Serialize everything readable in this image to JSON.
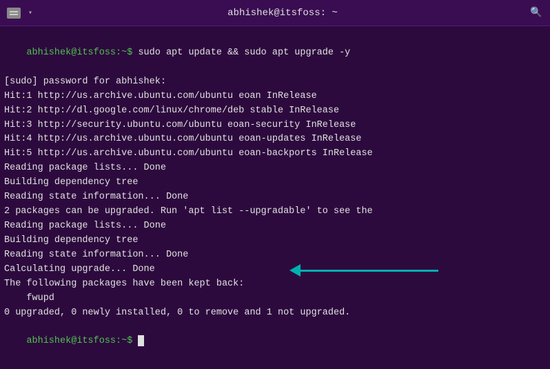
{
  "titleBar": {
    "title": "abhishek@itsfoss: ~",
    "searchIcon": "🔍"
  },
  "terminal": {
    "lines": [
      {
        "type": "prompt-command",
        "prompt": "abhishek@itsfoss:~$ ",
        "command": "sudo apt update && sudo apt upgrade -y"
      },
      {
        "type": "normal",
        "text": "[sudo] password for abhishek:"
      },
      {
        "type": "normal",
        "text": "Hit:1 http://us.archive.ubuntu.com/ubuntu eoan InRelease"
      },
      {
        "type": "normal",
        "text": "Hit:2 http://dl.google.com/linux/chrome/deb stable InRelease"
      },
      {
        "type": "normal",
        "text": "Hit:3 http://security.ubuntu.com/ubuntu eoan-security InRelease"
      },
      {
        "type": "normal",
        "text": "Hit:4 http://us.archive.ubuntu.com/ubuntu eoan-updates InRelease"
      },
      {
        "type": "normal",
        "text": "Hit:5 http://us.archive.ubuntu.com/ubuntu eoan-backports InRelease"
      },
      {
        "type": "normal",
        "text": "Reading package lists... Done"
      },
      {
        "type": "normal",
        "text": "Building dependency tree"
      },
      {
        "type": "normal",
        "text": "Reading state information... Done"
      },
      {
        "type": "normal",
        "text": "2 packages can be upgraded. Run 'apt list --upgradable' to see the"
      },
      {
        "type": "normal",
        "text": "Reading package lists... Done"
      },
      {
        "type": "normal",
        "text": "Building dependency tree"
      },
      {
        "type": "normal",
        "text": "Reading state information... Done"
      },
      {
        "type": "normal",
        "text": "Calculating upgrade... Done"
      },
      {
        "type": "normal",
        "text": "The following packages have been kept back:"
      },
      {
        "type": "normal",
        "text": "    fwupd"
      },
      {
        "type": "normal",
        "text": "0 upgraded, 0 newly installed, 0 to remove and 1 not upgraded."
      },
      {
        "type": "prompt-empty",
        "prompt": "abhishek@itsfoss:~$ "
      }
    ]
  }
}
